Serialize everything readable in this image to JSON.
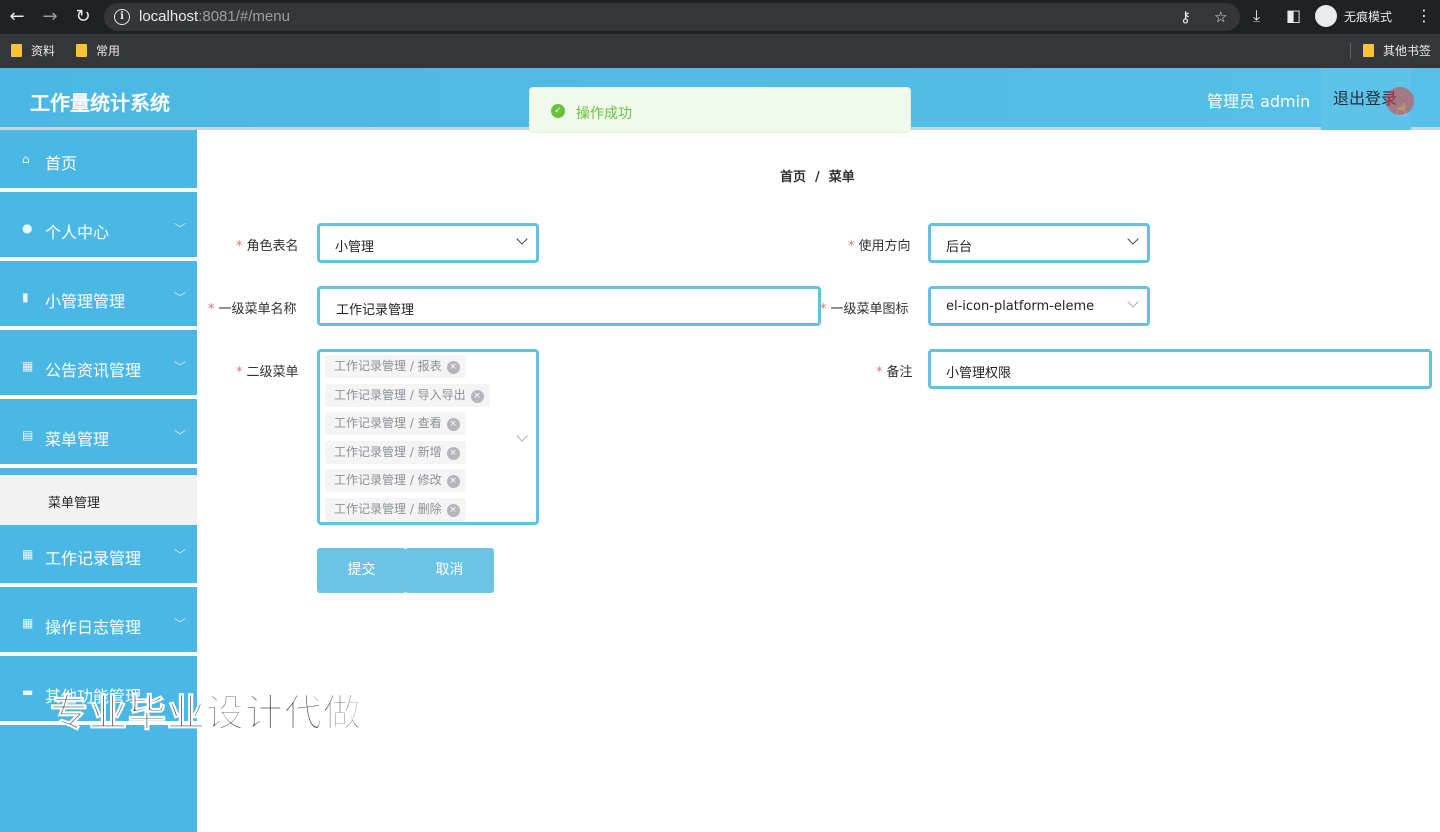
{
  "browser": {
    "url_host": "localhost",
    "url_path": ":8081/#/menu",
    "incognito_label": "无痕模式",
    "bookmarks": [
      "资料",
      "常用"
    ],
    "other_bookmarks": "其他书签"
  },
  "header": {
    "app_title": "工作量统计系统",
    "admin_label": "管理员 admin",
    "logout_label": "退出登录"
  },
  "toast": {
    "message": "操作成功",
    "type": "success"
  },
  "sidebar": {
    "items": [
      {
        "label": "首页",
        "icon": "home-icon"
      },
      {
        "label": "个人中心",
        "icon": "user-icon"
      },
      {
        "label": "小管理管理",
        "icon": "notebook-icon"
      },
      {
        "label": "公告资讯管理",
        "icon": "grid-icon"
      },
      {
        "label": "菜单管理",
        "icon": "clipboard-icon"
      },
      {
        "label": "工作记录管理",
        "icon": "grid-icon"
      },
      {
        "label": "操作日志管理",
        "icon": "grid-icon"
      },
      {
        "label": "其他功能管理",
        "icon": "chat-icon"
      }
    ],
    "active_sub": "菜单管理"
  },
  "watermark": "专业毕业设计代做",
  "breadcrumb": {
    "home": "首页",
    "separator": "/",
    "current": "菜单"
  },
  "form": {
    "role_label": "角色表名",
    "role_value": "小管理",
    "direction_label": "使用方向",
    "direction_value": "后台",
    "menu_name_label": "一级菜单名称",
    "menu_name_value": "工作记录管理",
    "menu_icon_label": "一级菜单图标",
    "menu_icon_value": "el-icon-platform-eleme",
    "submenu_label": "二级菜单",
    "submenu_tags": [
      "工作记录管理 / 报表",
      "工作记录管理 / 导入导出",
      "工作记录管理 / 查看",
      "工作记录管理 / 新增",
      "工作记录管理 / 修改",
      "工作记录管理 / 删除"
    ],
    "remark_label": "备注",
    "remark_value": "小管理权限",
    "required_mark": "*",
    "submit_label": "提交",
    "cancel_label": "取消"
  },
  "colors": {
    "primary": "#4bb7e4",
    "success": "#67c23a",
    "required": "#f56c6c",
    "field_border": "#65c1e3"
  }
}
